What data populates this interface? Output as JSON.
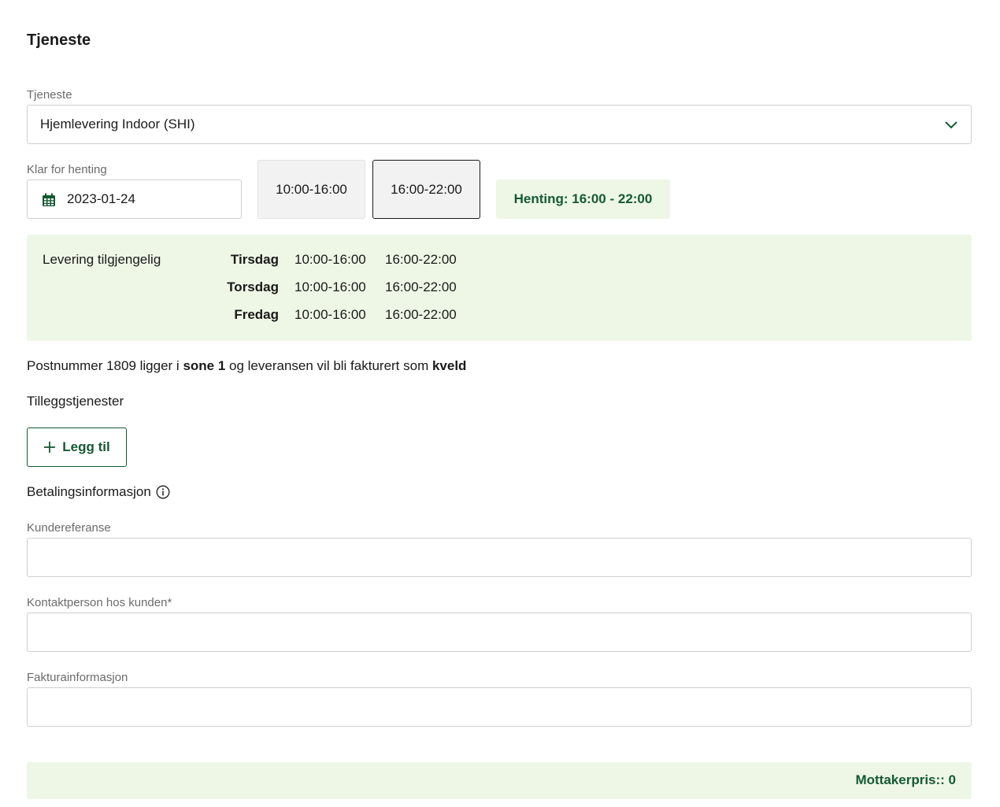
{
  "section": {
    "title": "Tjeneste"
  },
  "service": {
    "label": "Tjeneste",
    "selected": "Hjemlevering Indoor (SHI)"
  },
  "pickup": {
    "label": "Klar for henting",
    "date": "2023-01-24",
    "slots": [
      "10:00-16:00",
      "16:00-22:00"
    ],
    "selected_slot": "16:00-22:00",
    "badge": "Henting: 16:00 - 22:00"
  },
  "delivery": {
    "label": "Levering tilgjengelig",
    "days": [
      {
        "day": "Tirsdag",
        "slots": [
          "10:00-16:00",
          "16:00-22:00"
        ]
      },
      {
        "day": "Torsdag",
        "slots": [
          "10:00-16:00",
          "16:00-22:00"
        ]
      },
      {
        "day": "Fredag",
        "slots": [
          "10:00-16:00",
          "16:00-22:00"
        ]
      }
    ]
  },
  "zone": {
    "prefix": "Postnummer 1809 ligger i ",
    "zone": "sone 1",
    "middle": " og leveransen vil bli fakturert som ",
    "type": "kveld"
  },
  "addons": {
    "title": "Tilleggstjenester",
    "add_label": "Legg til"
  },
  "payment": {
    "title": "Betalingsinformasjon",
    "fields": [
      {
        "label": "Kundereferanse",
        "value": ""
      },
      {
        "label": "Kontaktperson hos kunden*",
        "value": ""
      },
      {
        "label": "Fakturainformasjon",
        "value": ""
      }
    ]
  },
  "price": {
    "text": "Mottakerpris:: 0"
  },
  "colors": {
    "accent": "#145a32",
    "panel": "#eef7e6"
  }
}
